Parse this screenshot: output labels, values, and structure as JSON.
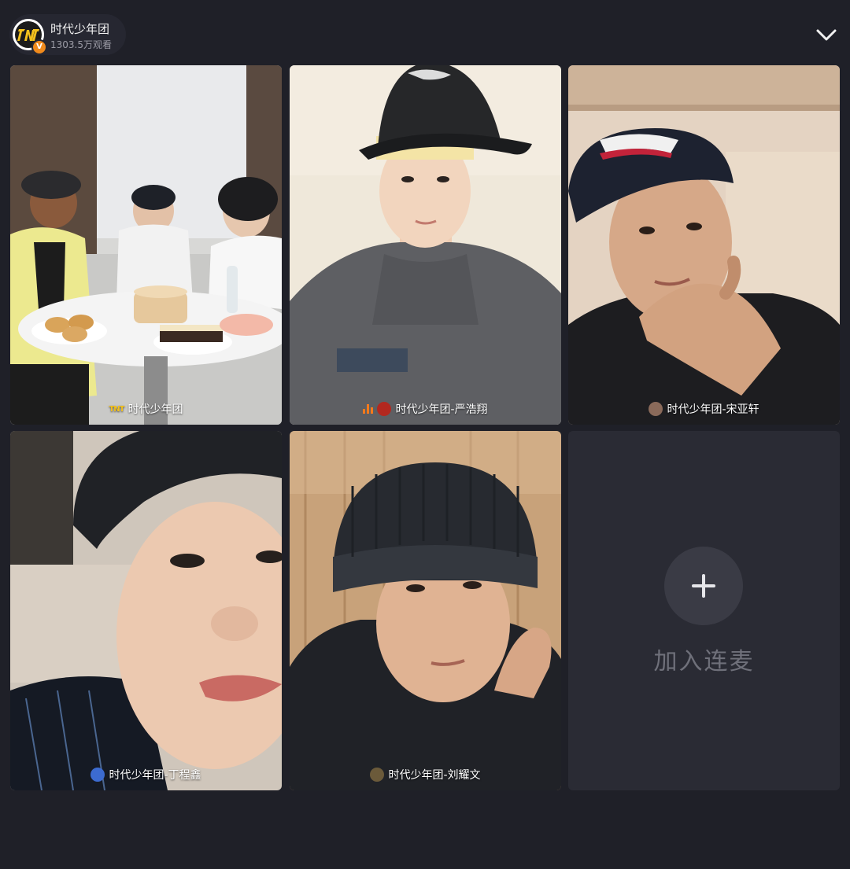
{
  "header": {
    "host_name": "时代少年团",
    "view_count": "1303.5万观看",
    "verified_badge": "V",
    "collapse_icon": "chevron-down-icon"
  },
  "tiles": [
    {
      "label": "时代少年团",
      "scene": "group-table-with-cakes",
      "speaking": false
    },
    {
      "label": "时代少年团-严浩翔",
      "scene": "selfie-black-cap",
      "speaking": true
    },
    {
      "label": "时代少年团-宋亚轩",
      "scene": "selfie-navy-cap-hand-on-chin",
      "speaking": false
    },
    {
      "label": "时代少年团-丁程鑫",
      "scene": "closeup-selfie-cap",
      "speaking": false
    },
    {
      "label": "时代少年团-刘耀文",
      "scene": "selfie-black-beanie-hoodie",
      "speaking": false
    }
  ],
  "join_slot": {
    "icon": "plus-icon",
    "label": "加入连麦"
  },
  "colors": {
    "background": "#1f2028",
    "empty_tile": "#2a2b34",
    "speaking_indicator": "#ff7a1a",
    "verified": "#f08a1c"
  }
}
